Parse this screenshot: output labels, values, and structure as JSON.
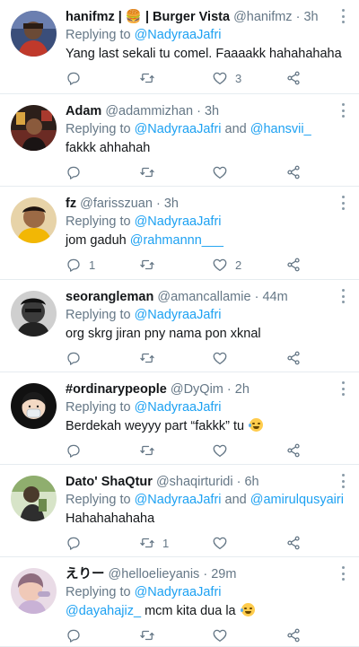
{
  "colors": {
    "accent": "#1da1f2",
    "secondary_text": "#657786",
    "divider": "#e6ecf0"
  },
  "icons": {
    "reply": "reply-icon",
    "retweet": "retweet-icon",
    "like": "like-icon",
    "share": "share-icon",
    "more": "more-icon"
  },
  "tweets": [
    {
      "name": "hanifmz | 🍔 | Burger Vista",
      "handle": "@hanifmz",
      "dot": "·",
      "time": "3h",
      "reply_prefix": "Replying to",
      "reply_to": "@NadyraaJafri",
      "reply_and": "",
      "reply_to2": "",
      "text": "Yang last sekali tu comel. Faaaakk hahahahaha",
      "text_mention": "",
      "emoji": "",
      "reply_count": "",
      "retweet_count": "",
      "like_count": "3"
    },
    {
      "name": "Adam",
      "handle": "@adammizhan",
      "dot": "·",
      "time": "3h",
      "reply_prefix": "Replying to",
      "reply_to": "@NadyraaJafri",
      "reply_and": " and ",
      "reply_to2": "@hansvii_",
      "text": "fakkk ahhahah",
      "text_mention": "",
      "emoji": "",
      "reply_count": "",
      "retweet_count": "",
      "like_count": ""
    },
    {
      "name": "fz",
      "handle": "@farisszuan",
      "dot": "·",
      "time": "3h",
      "reply_prefix": "Replying to",
      "reply_to": "@NadyraaJafri",
      "reply_and": "",
      "reply_to2": "",
      "text": "jom gaduh ",
      "text_mention": "@rahmannn___",
      "emoji": "",
      "reply_count": "1",
      "retweet_count": "",
      "like_count": "2"
    },
    {
      "name": "seorangleman",
      "handle": "@amancallamie",
      "dot": "·",
      "time": "44m",
      "reply_prefix": "Replying to",
      "reply_to": "@NadyraaJafri",
      "reply_and": "",
      "reply_to2": "",
      "text": "org skrg jiran pny nama pon xknal",
      "text_mention": "",
      "emoji": "",
      "reply_count": "",
      "retweet_count": "",
      "like_count": ""
    },
    {
      "name": "#ordinarypeople",
      "handle": "@DyQim",
      "dot": "·",
      "time": "2h",
      "reply_prefix": "Replying to",
      "reply_to": "@NadyraaJafri",
      "reply_and": "",
      "reply_to2": "",
      "text": "Berdekah weyyy part “fakkk” tu",
      "text_mention": "",
      "emoji": "🤣",
      "reply_count": "",
      "retweet_count": "",
      "like_count": ""
    },
    {
      "name": "Dato' ShaQtur",
      "handle": "@shaqirturidi",
      "dot": "·",
      "time": "6h",
      "reply_prefix": "Replying to",
      "reply_to": "@NadyraaJafri",
      "reply_and": " and ",
      "reply_to2": "@amirulqusyairi",
      "text": "Hahahahahaha",
      "text_mention": "",
      "emoji": "",
      "reply_count": "",
      "retweet_count": "1",
      "like_count": ""
    },
    {
      "name": "えりー",
      "handle": "@helloelieyanis",
      "dot": "·",
      "time": "29m",
      "reply_prefix": "Replying to",
      "reply_to": "@NadyraaJafri",
      "reply_and": "",
      "reply_to2": "",
      "text": " mcm kita dua la",
      "text_mention_first": "@dayahajiz_",
      "text_mention": "",
      "emoji": "😂",
      "reply_count": "",
      "retweet_count": "",
      "like_count": ""
    }
  ]
}
